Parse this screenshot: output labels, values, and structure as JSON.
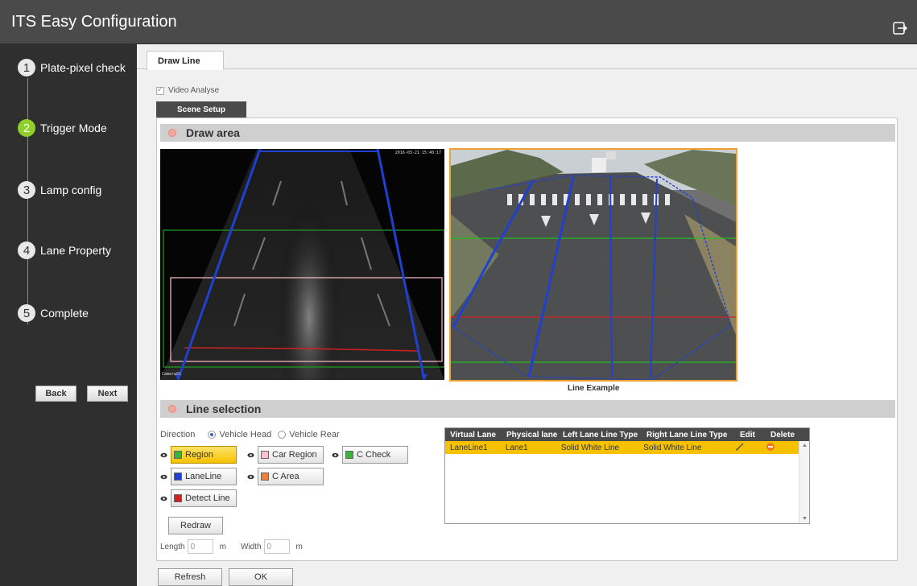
{
  "header": {
    "title": "ITS Easy Configuration",
    "exit_icon": "exit-icon"
  },
  "wizard": {
    "steps": [
      {
        "num": "1",
        "label": "Plate-pixel check"
      },
      {
        "num": "2",
        "label": "Trigger Mode"
      },
      {
        "num": "3",
        "label": "Lamp config"
      },
      {
        "num": "4",
        "label": "Lane Property"
      },
      {
        "num": "5",
        "label": "Complete"
      }
    ],
    "active_step": "2",
    "back_label": "Back",
    "next_label": "Next"
  },
  "main": {
    "tab": "Draw Line",
    "video_analyse_label": "Video Analyse",
    "scene_tab": "Scene Setup",
    "draw_area_title": "Draw area",
    "line_example_caption": "Line Example",
    "left_image": {
      "timestamp": "2016-03-21 15:40:17",
      "corner_label": "Camera01"
    },
    "line_selection_title": "Line selection",
    "direction": {
      "label": "Direction",
      "options": [
        "Vehicle Head",
        "Vehicle Rear"
      ],
      "selected": "Vehicle Head"
    },
    "line_options": {
      "region": {
        "label": "Region",
        "color": "#3cb43c"
      },
      "car_region": {
        "label": "Car Region",
        "color": "#ffc0cb"
      },
      "c_check": {
        "label": "C Check",
        "color": "#3cb43c"
      },
      "lane_line": {
        "label": "LaneLine",
        "color": "#2040d0"
      },
      "c_area": {
        "label": "C Area",
        "color": "#f08040"
      },
      "detect_line": {
        "label": "Detect Line",
        "color": "#d02020"
      }
    },
    "redraw_label": "Redraw",
    "length": {
      "label": "Length",
      "value": "0",
      "unit": "m"
    },
    "width": {
      "label": "Width",
      "value": "0",
      "unit": "m"
    },
    "lane_table": {
      "headers": [
        "Virtual Lane",
        "Physical lane",
        "Left Lane Line Type",
        "Right Lane Line Type",
        "Edit",
        "Delete"
      ],
      "rows": [
        {
          "virtual": "LaneLine1",
          "physical": "Lane1",
          "left": "Solid White Line",
          "right": "Solid White Line"
        }
      ]
    },
    "refresh_label": "Refresh",
    "ok_label": "OK"
  },
  "colors": {
    "header_bg": "#4a4a4a",
    "sidebar_bg": "#2f2f2f",
    "step_active": "#8fcf2a",
    "selected_yellow": "#f6c200",
    "lane_blue": "#2040d0",
    "detect_red": "#d02020"
  }
}
